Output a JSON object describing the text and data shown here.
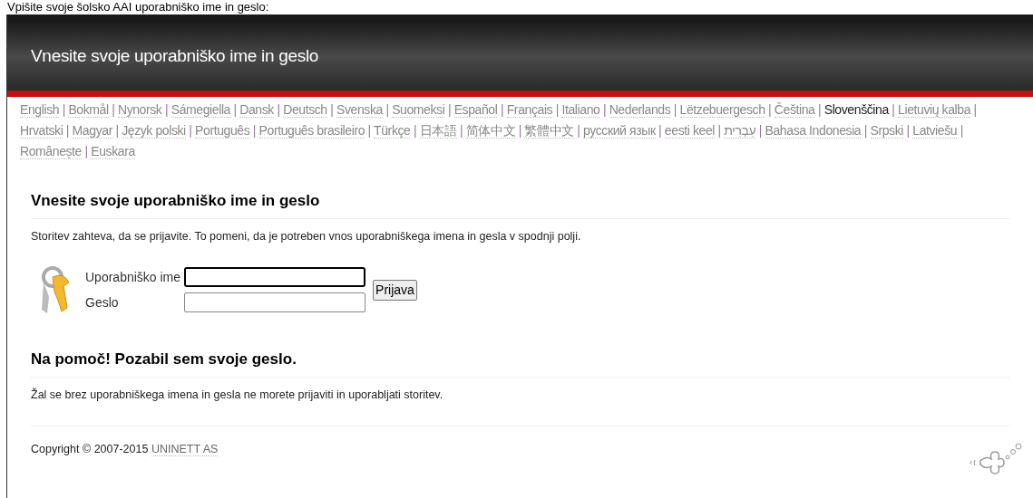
{
  "caption": "Vpišite svoje šolsko AAI uporabniško ime in geslo:",
  "header": {
    "title": "Vnesite svoje uporabniško ime in geslo"
  },
  "languages": [
    {
      "label": "English",
      "selected": false
    },
    {
      "label": "Bokmål",
      "selected": false
    },
    {
      "label": "Nynorsk",
      "selected": false
    },
    {
      "label": "Sámegiella",
      "selected": false
    },
    {
      "label": "Dansk",
      "selected": false
    },
    {
      "label": "Deutsch",
      "selected": false
    },
    {
      "label": "Svenska",
      "selected": false
    },
    {
      "label": "Suomeksi",
      "selected": false
    },
    {
      "label": "Español",
      "selected": false
    },
    {
      "label": "Français",
      "selected": false
    },
    {
      "label": "Italiano",
      "selected": false
    },
    {
      "label": "Nederlands",
      "selected": false
    },
    {
      "label": "Lëtzebuergesch",
      "selected": false
    },
    {
      "label": "Čeština",
      "selected": false
    },
    {
      "label": "Slovenščina",
      "selected": true
    },
    {
      "label": "Lietuvių kalba",
      "selected": false
    },
    {
      "label": "Hrvatski",
      "selected": false
    },
    {
      "label": "Magyar",
      "selected": false
    },
    {
      "label": "Język polski",
      "selected": false
    },
    {
      "label": "Português",
      "selected": false
    },
    {
      "label": "Português brasileiro",
      "selected": false
    },
    {
      "label": "Türkçe",
      "selected": false
    },
    {
      "label": "日本語",
      "selected": false
    },
    {
      "label": "简体中文",
      "selected": false
    },
    {
      "label": "繁體中文",
      "selected": false
    },
    {
      "label": "русский язык",
      "selected": false
    },
    {
      "label": "eesti keel",
      "selected": false
    },
    {
      "label": "עִבְרִית",
      "selected": false
    },
    {
      "label": "Bahasa Indonesia",
      "selected": false
    },
    {
      "label": "Srpski",
      "selected": false
    },
    {
      "label": "Latviešu",
      "selected": false
    },
    {
      "label": "Românește",
      "selected": false
    },
    {
      "label": "Euskara",
      "selected": false
    }
  ],
  "separator": "|",
  "login": {
    "heading": "Vnesite svoje uporabniško ime in geslo",
    "description": "Storitev zahteva, da se prijavite. To pomeni, da je potreben vnos uporabniškega imena in gesla v spodnji polji.",
    "username_label": "Uporabniško ime",
    "password_label": "Geslo",
    "submit": "Prijava"
  },
  "help": {
    "heading": "Na pomoč! Pozabil sem svoje geslo.",
    "text": "Žal se brez uporabniškega imena in gesla ne morete prijaviti in uporabljati storitev."
  },
  "footer": {
    "copyright": "Copyright © 2007-2015",
    "link": "UNINETT AS"
  }
}
